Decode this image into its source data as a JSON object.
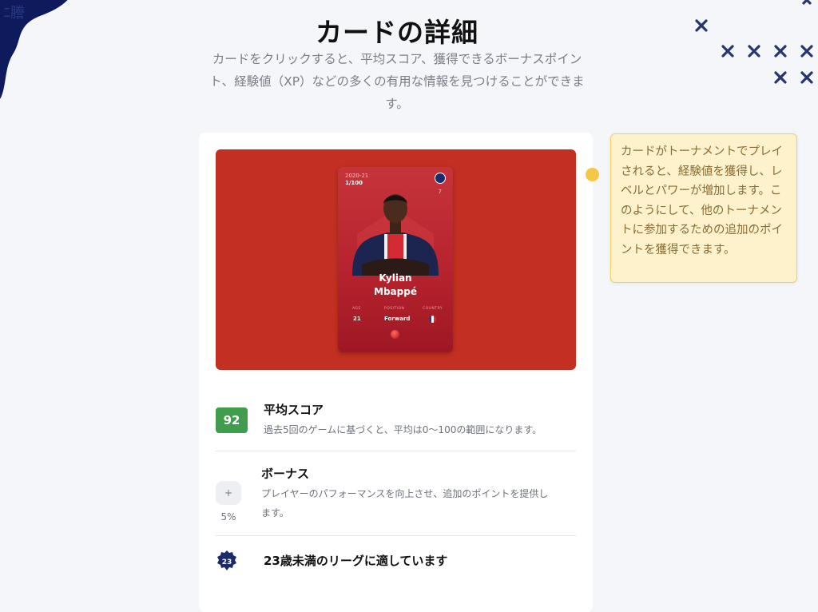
{
  "header": {
    "title": "カードの詳細",
    "subtitle": "カードをクリックすると、平均スコア、獲得できるボーナスポイント、経験値（XP）などの多くの有用な情報を見つけることができます。"
  },
  "card": {
    "season": "2020-21",
    "serial": "1/100",
    "shirt_number": "7",
    "first_name": "Kylian",
    "last_name": "Mbappé",
    "stat_headers": [
      "AGE",
      "POSITION",
      "COUNTRY"
    ],
    "age": "21",
    "position": "Forward",
    "hero_color": "#c33022"
  },
  "details": {
    "score": {
      "badge": "92",
      "title": "平均スコア",
      "desc": "過去5回のゲームに基づくと、平均は0〜100の範囲になります。",
      "badge_color": "#3f9d4c"
    },
    "bonus": {
      "badge": "+ 5%",
      "title": "ボーナス",
      "desc_line1": "プレイヤーのパフォーマンスを向上させ、追加のポイントを提供し",
      "desc_line2": "ます。"
    },
    "age": {
      "badge": "23",
      "title": "23歳未満のリーグに適しています"
    }
  },
  "tooltip": {
    "text": "カードがトーナメントでプレイされると、経験値を獲得し、レベルとパワーが増加します。このようにして、他のトーナメントに参加するための追加のポイントを獲得できます。"
  },
  "colors": {
    "accent_navy": "#1b2a6b",
    "tooltip_bg": "#fdf2cc",
    "dot": "#f6c746"
  },
  "icons": [
    "x-mark-icon",
    "age-badge-icon",
    "club-crest-icon",
    "flag-icon"
  ]
}
